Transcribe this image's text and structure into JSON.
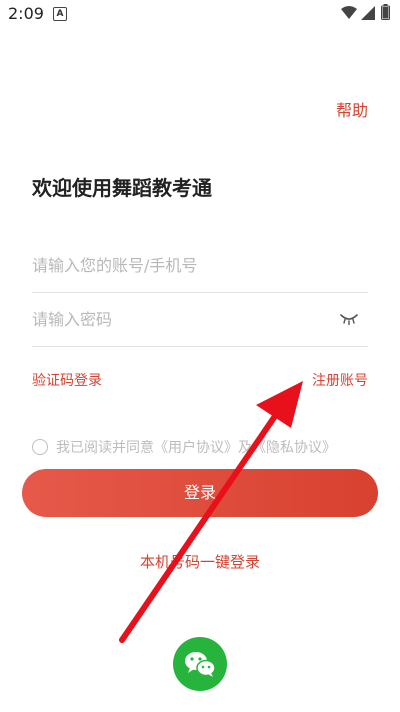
{
  "status_bar": {
    "time": "2:09",
    "indicator": "A",
    "icons": [
      "wifi-icon",
      "signal-icon",
      "battery-icon"
    ]
  },
  "header": {
    "help_label": "帮助"
  },
  "main": {
    "title": "欢迎使用舞蹈教考通",
    "account_placeholder": "请输入您的账号/手机号",
    "password_placeholder": "请输入密码",
    "code_login_label": "验证码登录",
    "register_label": "注册账号",
    "agreement": {
      "prefix": "我已阅读并同意",
      "user_agreement": "《用户协议》",
      "and": "及",
      "privacy_agreement": "《隐私协议》"
    },
    "login_label": "登录",
    "one_click_login_label": "本机号码一键登录"
  },
  "colors": {
    "accent": "#d44433",
    "button_start": "#e6594a",
    "button_end": "#d8412f",
    "wechat": "#27b43c",
    "annotation_arrow": "#e8101a"
  },
  "icons": {
    "password_toggle": "eye-closed-icon",
    "wechat": "wechat-icon"
  }
}
